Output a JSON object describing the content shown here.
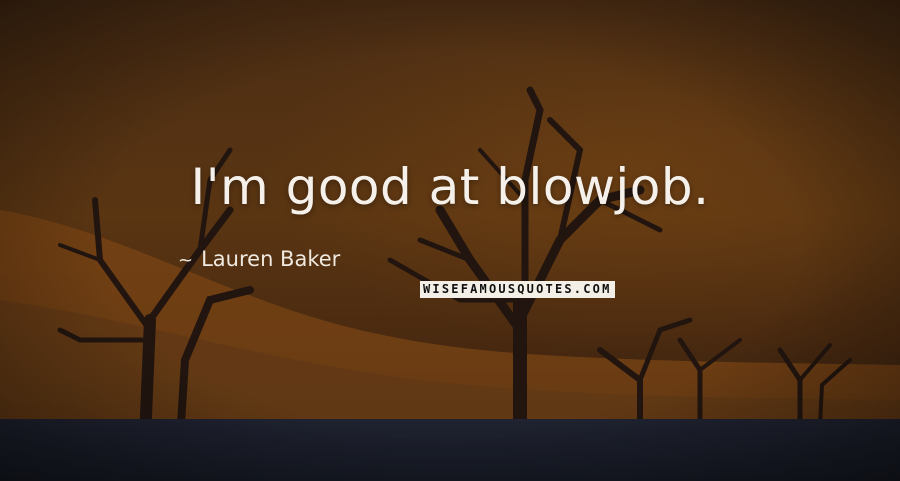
{
  "quote": {
    "text": "I'm good at blowjob.",
    "author": "Lauren Baker",
    "author_icon": "~"
  },
  "watermark": {
    "text": "WISEFAMOUSQUOTES.COM"
  },
  "colors": {
    "text": "#f5f1ea",
    "sky": "#5a3512",
    "dune": "#8a4f18",
    "ground": "#1c1f2b",
    "trees": "#2a1a12"
  }
}
